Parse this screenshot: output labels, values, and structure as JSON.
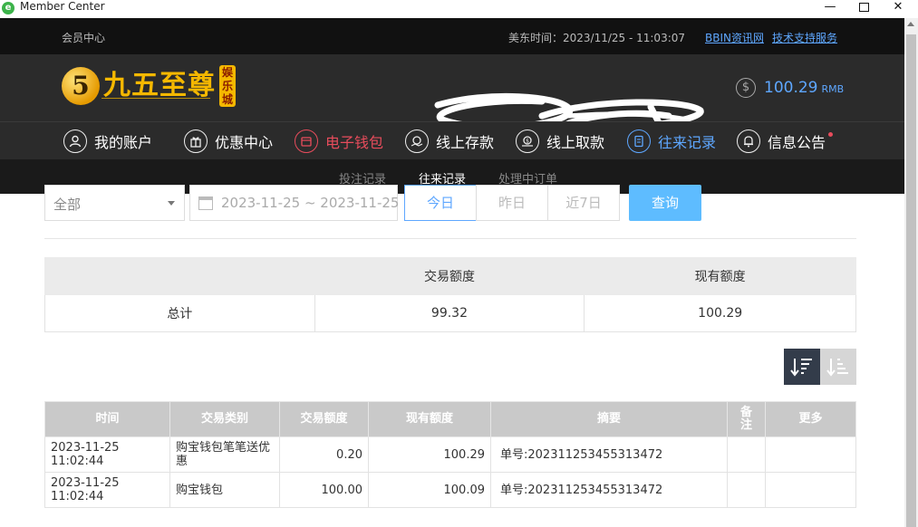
{
  "window": {
    "title": "Member Center"
  },
  "topbar": {
    "breadcrumb": "会员中心",
    "clock": "美东时间：2023/11/25 - 11:03:07",
    "link_news": "BBIN资讯网",
    "link_support": "技术支持服务"
  },
  "header": {
    "logo_digit": "5",
    "logo_text": "九五至尊",
    "logo_badge": "娱乐城",
    "balance_amount": "100.29",
    "balance_currency": "RMB"
  },
  "nav": {
    "items": [
      {
        "label": "我的账户",
        "icon": "user-icon"
      },
      {
        "label": "优惠中心",
        "icon": "gift-icon"
      },
      {
        "label": "电子钱包",
        "icon": "wallet-icon"
      },
      {
        "label": "线上存款",
        "icon": "deposit-icon"
      },
      {
        "label": "线上取款",
        "icon": "withdraw-icon"
      },
      {
        "label": "往来记录",
        "icon": "records-icon"
      },
      {
        "label": "信息公告",
        "icon": "bell-icon"
      }
    ]
  },
  "subnav": {
    "items": [
      "投注记录",
      "往来记录",
      "处理中订单"
    ],
    "active": "往来记录"
  },
  "filter": {
    "type_selected": "全部",
    "date_range": "2023-11-25 ~ 2023-11-25",
    "quick": [
      "今日",
      "昨日",
      "近7日"
    ],
    "search_label": "查询"
  },
  "summary": {
    "headers": [
      "",
      "交易额度",
      "现有额度"
    ],
    "row": [
      "总计",
      "99.32",
      "100.29"
    ]
  },
  "records": {
    "headers": [
      "时间",
      "交易类别",
      "交易额度",
      "现有额度",
      "摘要",
      "备注",
      "更多"
    ],
    "rows": [
      [
        "2023-11-25 11:02:44",
        "购宝钱包笔笔送优惠",
        "0.20",
        "100.29",
        "单号:202311253455313472",
        "",
        ""
      ],
      [
        "2023-11-25 11:02:44",
        "购宝钱包",
        "100.00",
        "100.09",
        "单号:202311253455313472",
        "",
        ""
      ]
    ]
  },
  "colors": {
    "accent": "#5ea7ff",
    "alert": "#e84c5c",
    "gold": "#f5b800",
    "dark_bg": "#2b2b2b"
  }
}
